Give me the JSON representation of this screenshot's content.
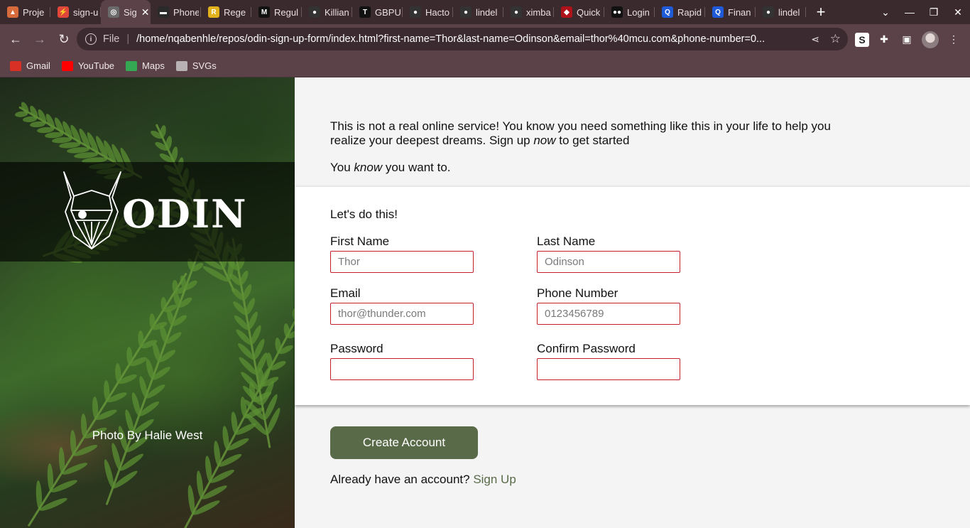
{
  "browser": {
    "tabs": [
      {
        "label": "Proje",
        "color": "#d86b3c",
        "glyph": "▲"
      },
      {
        "label": "sign-u",
        "color": "#e0463a",
        "glyph": "⚡"
      },
      {
        "label": "Sig",
        "color": "#6b6b6b",
        "glyph": "◎",
        "active": true
      },
      {
        "label": "Phone",
        "color": "#2a2a2a",
        "glyph": "▬"
      },
      {
        "label": "Rege",
        "color": "#e2b21c",
        "glyph": "R"
      },
      {
        "label": "Regul",
        "color": "#111111",
        "glyph": "M"
      },
      {
        "label": "Killian",
        "color": "#333333",
        "glyph": "●"
      },
      {
        "label": "GBPU",
        "color": "#111111",
        "glyph": "T"
      },
      {
        "label": "Hacto",
        "color": "#333333",
        "glyph": "●"
      },
      {
        "label": "lindel",
        "color": "#333333",
        "glyph": "●"
      },
      {
        "label": "ximba",
        "color": "#333333",
        "glyph": "●"
      },
      {
        "label": "Quick",
        "color": "#b0121a",
        "glyph": "◆"
      },
      {
        "label": "Login",
        "color": "#111111",
        "glyph": "●●"
      },
      {
        "label": "Rapid",
        "color": "#1f5bd8",
        "glyph": "Q"
      },
      {
        "label": "Finan",
        "color": "#1f5bd8",
        "glyph": "Q"
      },
      {
        "label": "lindel",
        "color": "#333333",
        "glyph": "●"
      }
    ],
    "new_tab": "+",
    "active_close": "✕",
    "window_controls": [
      "⌄",
      "—",
      "❐",
      "✕"
    ],
    "nav": {
      "back": "←",
      "forward": "→",
      "reload": "↻"
    },
    "address": {
      "scheme_label": "File",
      "url": "/home/nqabenhle/repos/odin-sign-up-form/index.html?first-name=Thor&last-name=Odinson&email=thor%40mcu.com&phone-number=0..."
    },
    "bookmarks": [
      {
        "label": "Gmail",
        "color": "#d93025"
      },
      {
        "label": "YouTube",
        "color": "#ff0000"
      },
      {
        "label": "Maps",
        "color": "#34a853"
      },
      {
        "label": "SVGs",
        "color": "#b9b2b4"
      }
    ]
  },
  "sidebar": {
    "logo_text": "ODIN",
    "credit": "Photo By Halie West"
  },
  "intro": {
    "line1_a": "This is not a real online service! You know you need something like this in your life to help you realize your deepest dreams. Sign up ",
    "line1_em": "now",
    "line1_b": " to get started",
    "line2_a": "You ",
    "line2_em": "know",
    "line2_b": " you want to."
  },
  "form": {
    "lead": "Let's do this!",
    "fields": {
      "first_name": {
        "label": "First Name",
        "placeholder": "Thor"
      },
      "last_name": {
        "label": "Last Name",
        "placeholder": "Odinson"
      },
      "email": {
        "label": "Email",
        "placeholder": "thor@thunder.com"
      },
      "phone": {
        "label": "Phone Number",
        "placeholder": "0123456789"
      },
      "password": {
        "label": "Password",
        "placeholder": ""
      },
      "confirm_password": {
        "label": "Confirm Password",
        "placeholder": ""
      }
    }
  },
  "actions": {
    "create_account": "Create Account",
    "already_text": "Already have an account? ",
    "sign_link": "Sign Up"
  },
  "colors": {
    "accent": "#596a48",
    "input_border": "#c4202a"
  }
}
